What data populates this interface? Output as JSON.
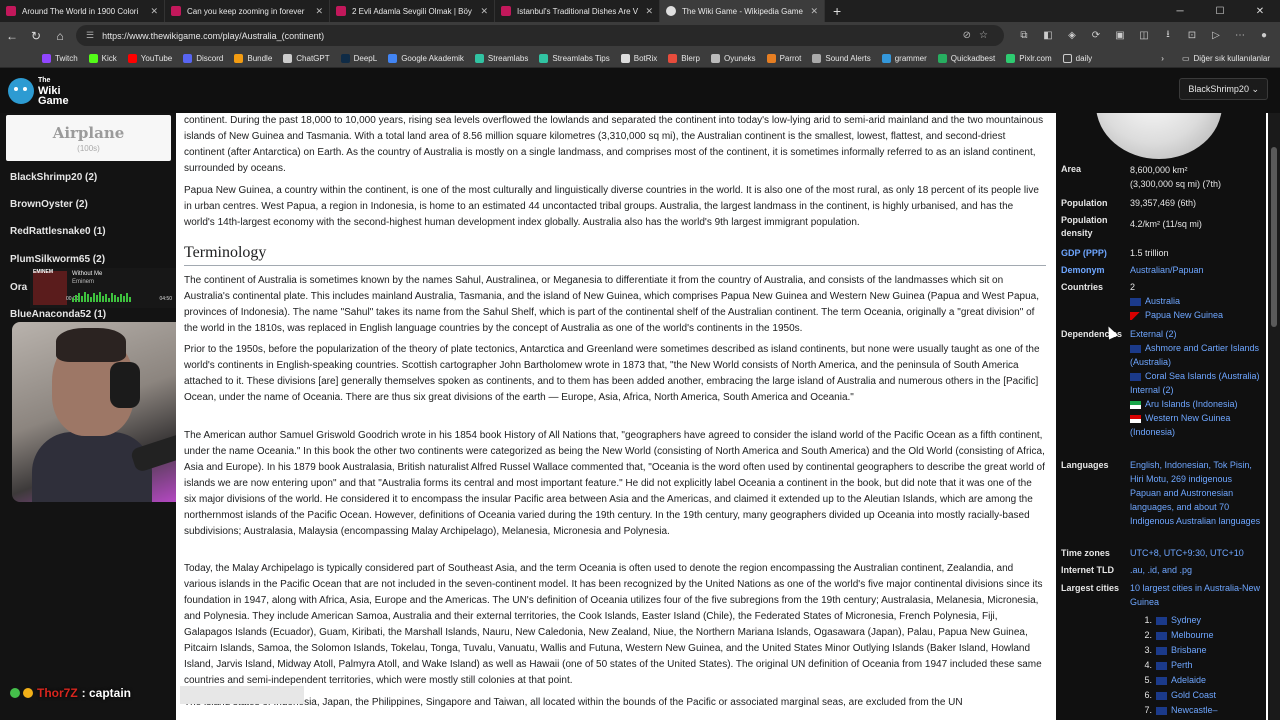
{
  "browser": {
    "tabs": [
      {
        "title": "Around The World in 1900 Colori"
      },
      {
        "title": "Can you keep zooming in forever"
      },
      {
        "title": "2 Evli Adamla Sevgili Olmak | Böy"
      },
      {
        "title": "Istanbul's Traditional Dishes Are V"
      },
      {
        "title": "The Wiki Game - Wikipedia Game"
      }
    ],
    "new_tab": "+",
    "url": "https://www.thewikigame.com/play/Australia_(continent)",
    "bookmarks": [
      "Twitch",
      "Kick",
      "YouTube",
      "Discord",
      "Bundle",
      "ChatGPT",
      "DeepL",
      "Google Akademik",
      "Streamlabs",
      "Streamlabs Tips",
      "BotRix",
      "Blerp",
      "Oyuneks",
      "Parrot",
      "Sound Alerts",
      "grammer",
      "Quickadbest",
      "Pixlr.com",
      "daily"
    ],
    "bookmarks_other": "Diğer sık kullanılanlar"
  },
  "game": {
    "logo_top": "The",
    "logo_main": "Wiki",
    "logo_bottom": "Game",
    "user": "BlackShrimp20 ⌄",
    "target_name": "Airplane",
    "target_par": "(100s)",
    "players": [
      "BlackShrimp20 (2)",
      "BrownOyster (2)",
      "RedRattlesnake0 (1)",
      "PlumSilkworm65 (2)",
      "Ora",
      "BlueAnaconda52 (1)"
    ]
  },
  "stream": {
    "music_artist_top": "EMINEM",
    "music_title": "Without Me",
    "music_artist": "Eminem",
    "time_start": "00:00",
    "time_end": "04:50",
    "chat_user": "Thor7Z",
    "chat_msg": ": captain"
  },
  "article": {
    "p1": "continent. During the past 18,000 to 10,000 years, rising sea levels overflowed the lowlands and separated the continent into today's low-lying arid to semi-arid mainland and the two mountainous islands of New Guinea and Tasmania. With a total land area of 8.56 million square kilometres (3,310,000 sq mi), the Australian continent is the smallest, lowest, flattest, and second-driest continent (after Antarctica) on Earth. As the country of Australia is mostly on a single landmass, and comprises most of the continent, it is sometimes informally referred to as an island continent, surrounded by oceans.",
    "p2": "Papua New Guinea, a country within the continent, is one of the most culturally and linguistically diverse countries in the world. It is also one of the most rural, as only 18 percent of its people live in urban centres. West Papua, a region in Indonesia, is home to an estimated 44 uncontacted tribal groups. Australia, the largest landmass in the continent, is highly urbanised, and has the world's 14th-largest economy with the second-highest human development index globally. Australia also has the world's 9th largest immigrant population.",
    "heading": "Terminology",
    "p3": "The continent of Australia is sometimes known by the names Sahul, Australinea, or Meganesia to differentiate it from the country of Australia, and consists of the landmasses which sit on Australia's continental plate. This includes mainland Australia, Tasmania, and the island of New Guinea, which comprises Papua New Guinea and Western New Guinea (Papua and West Papua, provinces of Indonesia). The name \"Sahul\" takes its name from the Sahul Shelf, which is part of the continental shelf of the Australian continent. The term Oceania, originally a \"great division\" of the world in the 1810s, was replaced in English language countries by the concept of Australia as one of the world's continents in the 1950s.",
    "p4": "Prior to the 1950s, before the popularization of the theory of plate tectonics, Antarctica and Greenland were sometimes described as island continents, but none were usually taught as one of the world's continents in English-speaking countries. Scottish cartographer John Bartholomew wrote in 1873 that, \"the New World consists of North America, and the peninsula of South America attached to it. These divisions [are] generally themselves spoken as continents, and to them has been added another, embracing the large island of Australia and numerous others in the [Pacific] Ocean, under the name of Oceania. There are thus six great divisions of the earth — Europe, Asia, Africa, North America, South America and Oceania.\"",
    "p5": "The American author Samuel Griswold Goodrich wrote in his 1854 book History of All Nations that, \"geographers have agreed to consider the island world of the Pacific Ocean as a fifth continent, under the name Oceania.\" In this book the other two continents were categorized as being the New World (consisting of North America and South America) and the Old World (consisting of Africa, Asia and Europe). In his 1879 book Australasia, British naturalist Alfred Russel Wallace commented that, \"Oceania is the word often used by continental geographers to describe the great world of islands we are now entering upon\" and that \"Australia forms its central and most important feature.\" He did not explicitly label Oceania a continent in the book, but did note that it was one of the six major divisions of the world. He considered it to encompass the insular Pacific area between Asia and the Americas, and claimed it extended up to the Aleutian Islands, which are among the northernmost islands of the Pacific Ocean. However, definitions of Oceania varied during the 19th century. In the 19th century, many geographers divided up Oceania into mostly racially-based subdivisions; Australasia, Malaysia (encompassing Malay Archipelago), Melanesia, Micronesia and Polynesia.",
    "p6": "Today, the Malay Archipelago is typically considered part of Southeast Asia, and the term Oceania is often used to denote the region encompassing the Australian continent, Zealandia, and various islands in the Pacific Ocean that are not included in the seven-continent model. It has been recognized by the United Nations as one of the world's five major continental divisions since its foundation in 1947, along with Africa, Asia, Europe and the Americas. The UN's definition of Oceania utilizes four of the five subregions from the 19th century; Australasia, Melanesia, Micronesia, and Polynesia. They include American Samoa, Australia and their external territories, the Cook Islands, Easter Island (Chile), the Federated States of Micronesia, French Polynesia, Fiji, Galapagos Islands (Ecuador), Guam, Kiribati, the Marshall Islands, Nauru, New Caledonia, New Zealand, Niue, the Northern Mariana Islands, Ogasawara (Japan), Palau, Papua New Guinea, Pitcairn Islands, Samoa, the Solomon Islands, Tokelau, Tonga, Tuvalu, Vanuatu, Wallis and Futuna, Western New Guinea, and the United States Minor Outlying Islands (Baker Island, Howland Island, Jarvis Island, Midway Atoll, Palmyra Atoll, and Wake Island) as well as Hawaii (one of 50 states of the United States). The original UN definition of Oceania from 1947 included these same countries and semi-independent territories, which were mostly still colonies at that point.",
    "p7": "The island states of Indonesia, Japan, the Philippines, Singapore and Taiwan, all located within the bounds of the Pacific or associated marginal seas, are excluded from the UN"
  },
  "infobox": {
    "area_label": "Area",
    "area_value": "8,600,000 km²",
    "area_value2": "(3,300,000 sq mi) (7th)",
    "population_label": "Population",
    "population_value": "39,357,469 (6th)",
    "density_label": "Population density",
    "density_value": "4.2/km² (11/sq mi)",
    "gdp_label": "GDP (PPP)",
    "gdp_value": "1.5 trillion",
    "demonym_label": "Demonym",
    "demonym_value": "Australian/Papuan",
    "countries_label": "Countries",
    "countries_count": "2",
    "countries": [
      "Australia",
      "Papua New Guinea"
    ],
    "dependencies_label": "Dependencies",
    "dep_external": "External (2)",
    "dep_ext_items": [
      "Ashmore and Cartier Islands (Australia)",
      "Coral Sea Islands (Australia)"
    ],
    "dep_internal": "Internal (2)",
    "dep_int_items": [
      "Aru Islands (Indonesia)",
      "Western New Guinea (Indonesia)"
    ],
    "languages_label": "Languages",
    "languages_value": "English, Indonesian, Tok Pisin, Hiri Motu, 269 indigenous Papuan and Austronesian languages, and about 70 Indigenous Australian languages",
    "timezones_label": "Time zones",
    "timezones_value": "UTC+8, UTC+9:30, UTC+10",
    "tld_label": "Internet TLD",
    "tld_value": ".au, .id, and .pg",
    "cities_label": "Largest cities",
    "cities_intro": "10 largest cities in Australia-New Guinea",
    "cities": [
      "Sydney",
      "Melbourne",
      "Brisbane",
      "Perth",
      "Adelaide",
      "Gold Coast",
      "Newcastle–"
    ]
  },
  "colors": {
    "link": "#3366cc",
    "dark_bg": "#101010",
    "chat_user": "#d8261e"
  }
}
